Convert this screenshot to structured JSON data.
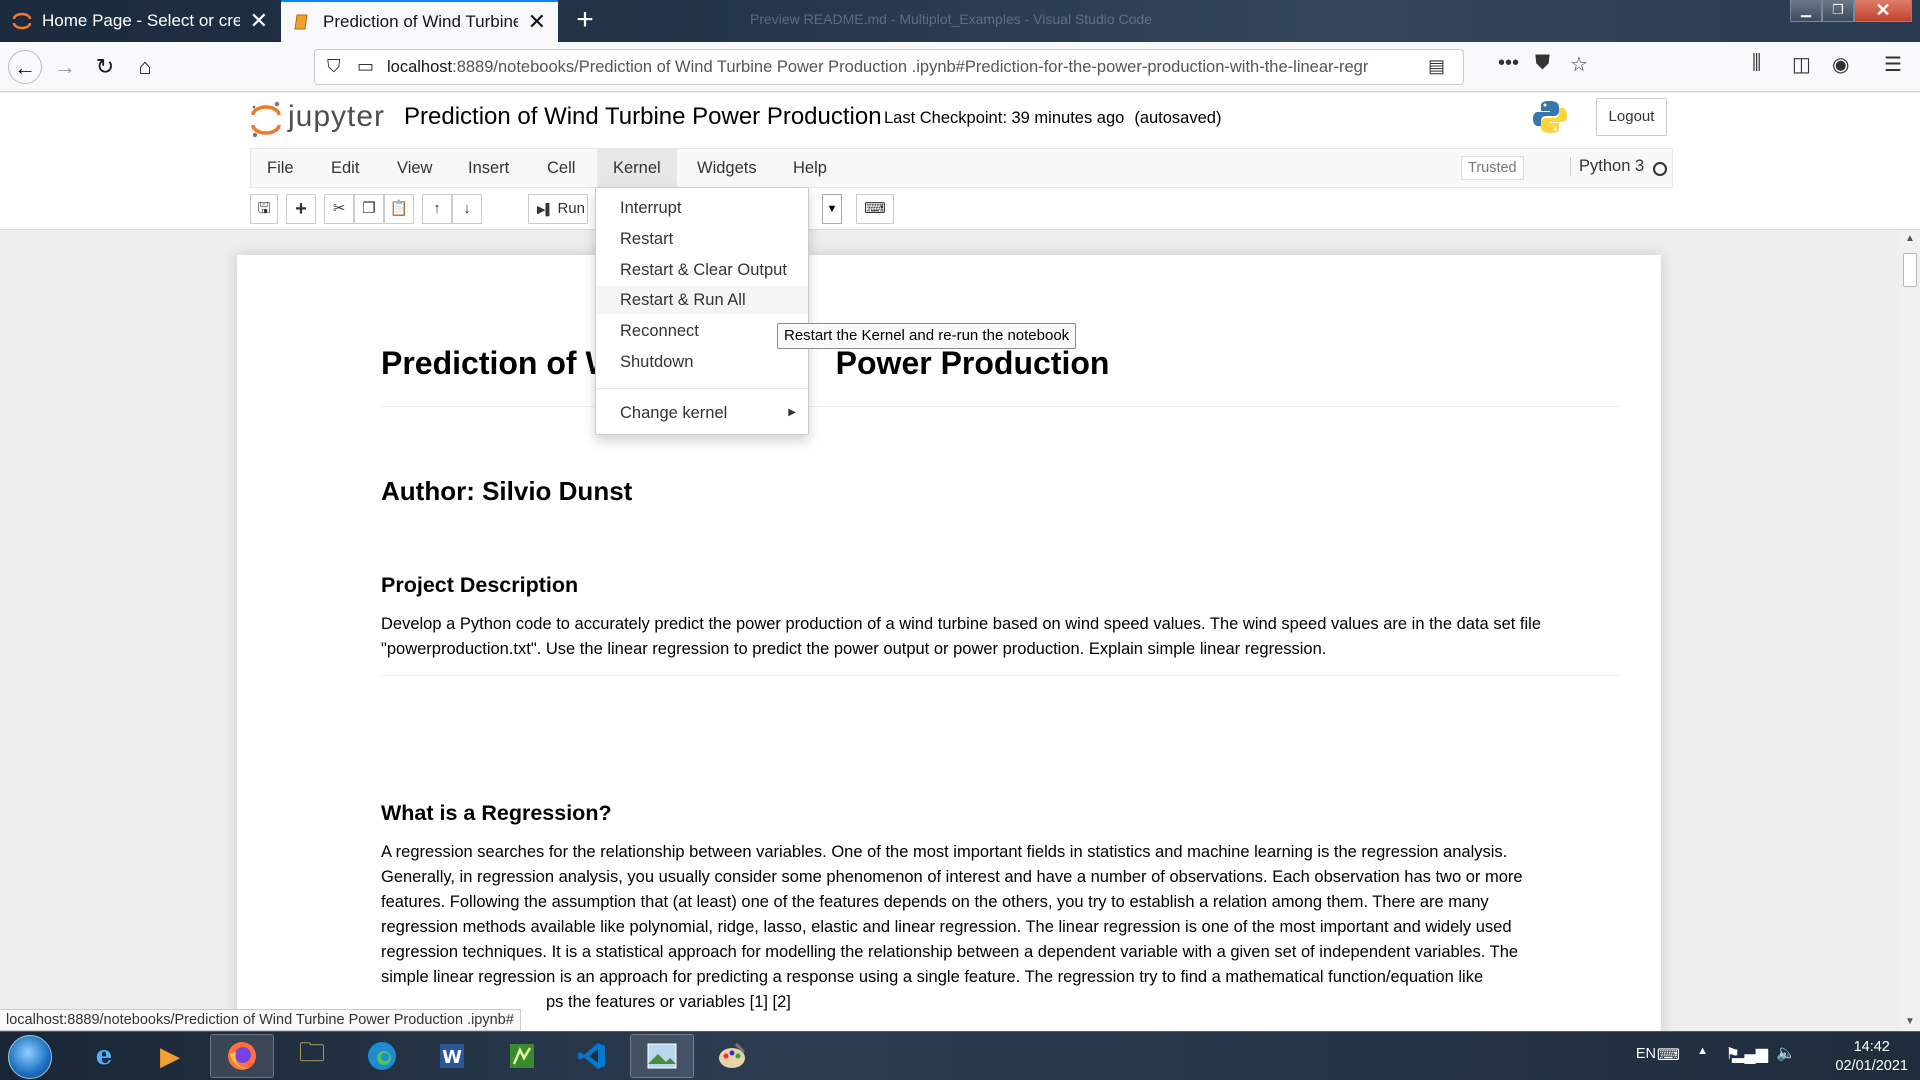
{
  "browser": {
    "tabs": [
      {
        "title": "Home Page - Select or create a",
        "close": "✕"
      },
      {
        "title": "Prediction of Wind Turbine Pov",
        "close": "✕"
      }
    ],
    "new_tab": "+",
    "window_title": "Preview README.md - Multiplot_Examples - Visual Studio Code",
    "url_host": "localhost",
    "url_rest": ":8889/notebooks/Prediction of Wind Turbine Power Production .ipynb#Prediction-for-the-power-production-with-the-linear-regr"
  },
  "jupyter": {
    "logo_text": "jupyter",
    "notebook_title": "Prediction of Wind Turbine Power Production",
    "checkpoint": "Last Checkpoint: 39 minutes ago",
    "autosaved": "(autosaved)",
    "logout": "Logout",
    "menus": [
      "File",
      "Edit",
      "View",
      "Insert",
      "Cell",
      "Kernel",
      "Widgets",
      "Help"
    ],
    "trusted": "Trusted",
    "kernel_name": "Python 3",
    "run_label": "Run"
  },
  "kernel_menu": {
    "items": [
      "Interrupt",
      "Restart",
      "Restart & Clear Output",
      "Restart & Run All",
      "Reconnect",
      "Shutdown"
    ],
    "change_kernel": "Change kernel",
    "tooltip": "Restart the Kernel and re-run the notebook"
  },
  "notebook": {
    "title_left": "Prediction of W",
    "title_right": "Power Production",
    "author": "Author: Silvio Dunst",
    "project_heading": "Project Description",
    "project_line1": "Develop a Python code to accurately predict the power production of a wind turbine based on wind speed values. The wind speed values are in the data set file",
    "project_line2": "\"powerproduction.txt\". Use the linear regression to predict the power output or power production. Explain simple linear regression.",
    "regression_heading": "What is a Regression?",
    "regression_lines": [
      "A regression searches for the relationship between variables. One of the most important fields in statistics and machine learning is the regression analysis.",
      "Generally, in regression analysis, you usually consider some phenomenon of interest and have a number of observations. Each observation has two or more",
      "features. Following the assumption that (at least) one of the features depends on the others, you try to establish a relation among them. There are many",
      "regression methods available like polynomial, ridge, lasso, elastic and linear regression. The linear regression is one of the most important and widely used",
      "regression techniques. It is a statistical approach for modelling the relationship between a dependent variable with a given set of independent variables. The",
      "simple linear regression is an approach for predicting a response using a single feature. The regression try to find a mathematical function/equation like",
      "ps the features or variables [1] [2]"
    ]
  },
  "status_url": "localhost:8889/notebooks/Prediction of Wind Turbine Power Production .ipynb#",
  "taskbar": {
    "language": "EN",
    "time": "14:42",
    "date": "02/01/2021"
  }
}
